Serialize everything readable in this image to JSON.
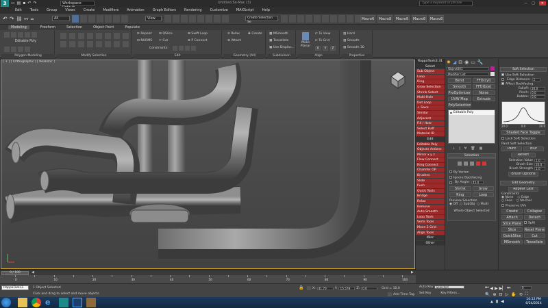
{
  "titlebar": {
    "workspace": "Workspace: Default",
    "title": "Untitled.Se-Mac (3)",
    "search_placeholder": "Type a keyword or phrase"
  },
  "menubar": [
    "Edit",
    "Tools",
    "Group",
    "Views",
    "Create",
    "Modifiers",
    "Animation",
    "Graph Editors",
    "Rendering",
    "Customize",
    "MAXScript",
    "Help"
  ],
  "toolbar": {
    "selection_filter": "All",
    "view_dropdown": "View",
    "named_selection": "Create Selection Se",
    "macros": [
      "Macro6",
      "Macro8",
      "Macro8",
      "Macro8",
      "Macro8"
    ]
  },
  "ribbon": {
    "tabs": [
      "Modeling",
      "Freeform",
      "Selection",
      "Object Paint",
      "Populate"
    ],
    "active_tab": "Modeling",
    "groups": {
      "polygon_modeling": {
        "label": "Polygon Modeling",
        "dropdown": "Editable Poly"
      },
      "modify_selection": {
        "label": "Modify Selection"
      },
      "edit": {
        "label": "Edit",
        "buttons": [
          "Repeat",
          "QSlice",
          "Swift Loop",
          "NURMS",
          "Cut",
          "P Connect",
          "Constraints:"
        ]
      },
      "geometry": {
        "label": "Geometry (All)",
        "buttons": [
          "Relax",
          "Create",
          "Attach"
        ]
      },
      "subdivision": {
        "label": "Subdivision",
        "buttons": [
          "MSmooth",
          "Tessellate",
          "Use Displac..."
        ]
      },
      "align": {
        "label": "Align",
        "buttons": [
          "Make Planar",
          "To View",
          "To Grid",
          "X",
          "Y",
          "Z"
        ]
      },
      "properties": {
        "label": "Properties",
        "buttons": [
          "Hard",
          "Smooth",
          "Smooth 30"
        ]
      }
    }
  },
  "viewport": {
    "label": "[ + ] [ Orthographic ] [ Realistic ]"
  },
  "ropes": {
    "title": "RappaTools3.31",
    "items": [
      {
        "label": "Select",
        "style": "head"
      },
      {
        "label": "Sub Object",
        "style": "red"
      },
      {
        "label": "Loop",
        "style": "red"
      },
      {
        "label": "Ring",
        "style": "red"
      },
      {
        "label": "Grow Selection",
        "style": "red"
      },
      {
        "label": "Shrink Select",
        "style": "red"
      },
      {
        "label": "Multi-Hole",
        "style": "red"
      },
      {
        "label": "Dot Loop",
        "style": "red"
      },
      {
        "label": "+ Save",
        "style": "red"
      },
      {
        "label": "Similar",
        "style": "red"
      },
      {
        "label": "Adjacent",
        "style": "red"
      },
      {
        "label": "Fill / Hole",
        "style": "red"
      },
      {
        "label": "Select Half",
        "style": "red"
      },
      {
        "label": "Material ID",
        "style": "red"
      },
      {
        "label": "Edit",
        "style": "head"
      },
      {
        "label": "Editable Poly",
        "style": "red"
      },
      {
        "label": "Objects Actions",
        "style": "red"
      },
      {
        "label": "Mirror  x  y  z",
        "style": "red"
      },
      {
        "label": "Flow Connect",
        "style": "red"
      },
      {
        "label": "Ring Connect",
        "style": "red"
      },
      {
        "label": "Chamfer OP",
        "style": "red"
      },
      {
        "label": "Brushes",
        "style": "red"
      },
      {
        "label": "Slide",
        "style": "red"
      },
      {
        "label": "Push",
        "style": "red"
      },
      {
        "label": "Quick Tools",
        "style": "red"
      },
      {
        "label": "Bridge",
        "style": "red"
      },
      {
        "label": "Relax",
        "style": "red"
      },
      {
        "label": "Remove",
        "style": "red"
      },
      {
        "label": "Auto Smooth",
        "style": "red"
      },
      {
        "label": "Loop Tools",
        "style": "red"
      },
      {
        "label": "Verts Tools",
        "style": "red"
      },
      {
        "label": "Move 2 Grid",
        "style": "red"
      },
      {
        "label": "Align Tools",
        "style": "red"
      },
      {
        "label": "Misc",
        "style": "head"
      },
      {
        "label": "Other",
        "style": "head"
      }
    ]
  },
  "cmdpanel": {
    "object_name": "Object001",
    "modifier_list": "Modifier List",
    "mod_buttons": [
      "Bend",
      "FFD(cyl)",
      "Smooth",
      "FFD(box)",
      "ProOptimizer",
      "Noise",
      "UVW Map",
      "Extrude"
    ],
    "poly_select": "PolySelection",
    "stack_item": "Editable Poly",
    "selection_title": "Selection",
    "by_vertex": "By Vertex",
    "ignore_backfacing": "Ignore Backfacing",
    "by_angle": "By Angle:",
    "by_angle_value": "45.0",
    "shrink": "Shrink",
    "grow": "Grow",
    "ring": "Ring",
    "loop": "Loop",
    "preview_selection": "Preview Selection",
    "preview_opts": [
      "Off",
      "SubObj",
      "Multi"
    ],
    "whole_object": "Whole Object Selected"
  },
  "softpanel": {
    "soft_title": "Soft Selection",
    "use_soft": "Use Soft Selection",
    "edge_distance": "Edge Distance:",
    "edge_distance_value": "1",
    "affect_backfacing": "Affect Backfacing",
    "falloff": "Falloff:",
    "falloff_value": "20.0",
    "pinch": "Pinch:",
    "pinch_value": "0.0",
    "bubble": "Bubble:",
    "bubble_value": "0.0",
    "curve_ticks": [
      "20.0",
      "0.0",
      "20.0"
    ],
    "shaded_face": "Shaded Face Toggle",
    "lock_soft": "Lock Soft Selection",
    "paint_title": "Paint Soft Selection",
    "paint": "Paint",
    "blur": "Blur",
    "revert": "Revert",
    "selection_value": "Selection Value",
    "sel_val": "1.0",
    "brush_size": "Brush Size",
    "brush_size_val": "20.0",
    "brush_strength": "Brush Strength",
    "brush_strength_val": "1.0",
    "brush_options": "Brush Options",
    "edit_geometry": "Edit Geometry",
    "repeat_last": "Repeat Last",
    "constraints": "Constraints",
    "none": "None",
    "edge": "Edge",
    "face": "Face",
    "normal": "Normal",
    "preserve_uvs": "Preserve UVs",
    "create": "Create",
    "collapse": "Collapse",
    "attach": "Attach",
    "detach": "Detach",
    "slice_plane": "Slice Plane",
    "split": "Split",
    "slice": "Slice",
    "reset_plane": "Reset Plane",
    "quickslice": "QuickSlice",
    "cut": "Cut",
    "msmooth": "MSmooth",
    "tessellate": "Tessellate"
  },
  "timeline": {
    "frame": "0 / 100",
    "ticks": [
      "0",
      "10",
      "20",
      "30",
      "40",
      "50",
      "60",
      "70",
      "80",
      "90",
      "100"
    ]
  },
  "statusbar": {
    "maxscript_field": "RappaTools3.",
    "objects_selected": "1 Object Selected",
    "prompt": "Click and drag to select and move objects",
    "x_label": "X:",
    "x_val": "41.70",
    "y_label": "Y:",
    "y_val": "15.578",
    "z_label": "Z:",
    "z_val": "0.0",
    "grid": "Grid = 10.0",
    "add_time_tag": "Add Time Tag",
    "auto_key": "Auto Key",
    "set_key": "Set Key",
    "selected": "Selected",
    "key_filters": "Key Filters...",
    "frame_val": "0"
  },
  "taskbar": {
    "time": "10:12 PM",
    "date": "6/24/2014"
  }
}
